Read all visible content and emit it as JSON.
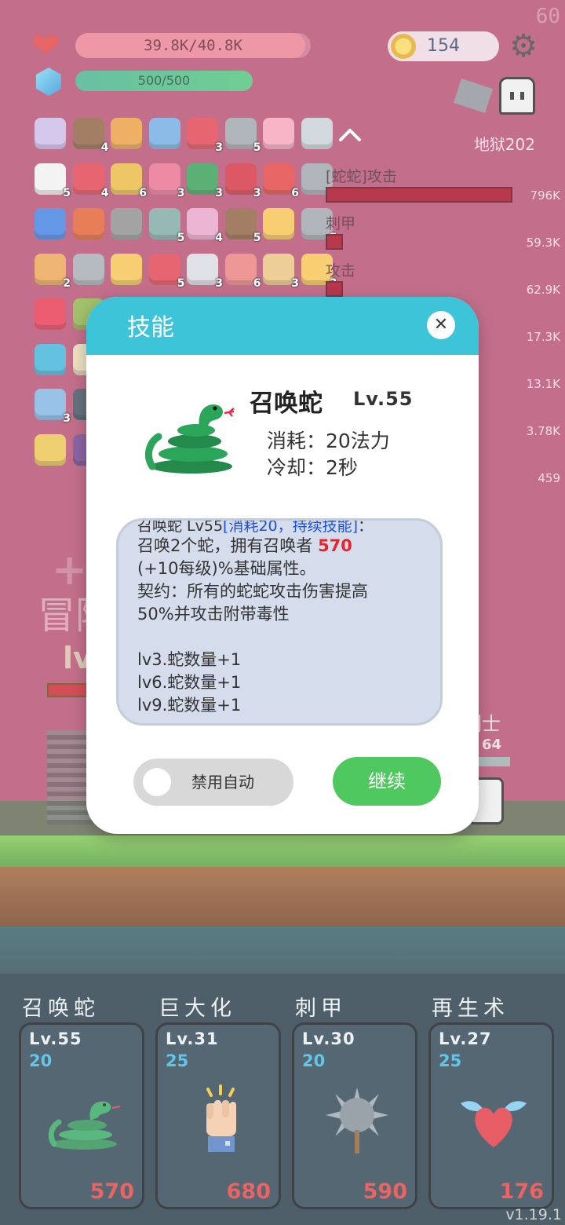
{
  "fps": "60",
  "hud": {
    "hp_text": "39.8K/40.8K",
    "hp_ratio": 0.976,
    "mp_text": "500/500",
    "mp_ratio": 1.0,
    "coins": "154",
    "stage": "地狱202"
  },
  "items": [
    {
      "row": 0,
      "col": 0,
      "color": "#c8b9e8",
      "count": ""
    },
    {
      "row": 0,
      "col": 1,
      "color": "#8a5a3a",
      "count": "4"
    },
    {
      "row": 0,
      "col": 2,
      "color": "#e89a3a",
      "count": ""
    },
    {
      "row": 0,
      "col": 3,
      "color": "#6aa9e0",
      "count": ""
    },
    {
      "row": 0,
      "col": 4,
      "color": "#e03a4a",
      "count": "3"
    },
    {
      "row": 0,
      "col": 5,
      "color": "#9aa0a8",
      "count": "5"
    },
    {
      "row": 0,
      "col": 6,
      "color": "#f5a0b8",
      "count": ""
    },
    {
      "row": 0,
      "col": 7,
      "color": "#c5cdd5",
      "count": ""
    },
    {
      "row": 1,
      "col": 0,
      "color": "#f0f0f0",
      "count": "5"
    },
    {
      "row": 1,
      "col": 1,
      "color": "#e03a4a",
      "count": "4"
    },
    {
      "row": 1,
      "col": 2,
      "color": "#e8b73a",
      "count": "6"
    },
    {
      "row": 1,
      "col": 3,
      "color": "#e86a8a",
      "count": "3"
    },
    {
      "row": 1,
      "col": 4,
      "color": "#2e9a4f",
      "count": "3"
    },
    {
      "row": 1,
      "col": 5,
      "color": "#d42a3a",
      "count": "3"
    },
    {
      "row": 1,
      "col": 6,
      "color": "#e03a3a",
      "count": "6"
    },
    {
      "row": 1,
      "col": 7,
      "color": "#9aa0a8",
      "count": "5"
    },
    {
      "row": 2,
      "col": 0,
      "color": "#3a7ae0",
      "count": ""
    },
    {
      "row": 2,
      "col": 1,
      "color": "#e05a2a",
      "count": ""
    },
    {
      "row": 2,
      "col": 2,
      "color": "#8a8a8a",
      "count": ""
    },
    {
      "row": 2,
      "col": 3,
      "color": "#7aa6a0",
      "count": "5"
    },
    {
      "row": 2,
      "col": 4,
      "color": "#e8a0c8",
      "count": "4"
    },
    {
      "row": 2,
      "col": 5,
      "color": "#8a5a3a",
      "count": "5"
    },
    {
      "row": 2,
      "col": 6,
      "color": "#f5c04a",
      "count": ""
    },
    {
      "row": 2,
      "col": 7,
      "color": "#9aa0a8",
      "count": "5"
    },
    {
      "row": 3,
      "col": 0,
      "color": "#e8a04a",
      "count": "2"
    },
    {
      "row": 3,
      "col": 1,
      "color": "#a0a8b0",
      "count": ""
    },
    {
      "row": 3,
      "col": 2,
      "color": "#f5c04a",
      "count": ""
    },
    {
      "row": 3,
      "col": 3,
      "color": "#e03a4a",
      "count": "5"
    },
    {
      "row": 3,
      "col": 4,
      "color": "#d8d8e0",
      "count": "3"
    },
    {
      "row": 3,
      "col": 5,
      "color": "#e87a7a",
      "count": "6"
    },
    {
      "row": 3,
      "col": 6,
      "color": "#e8c07a",
      "count": "3"
    },
    {
      "row": 3,
      "col": 7,
      "color": "#f5c04a",
      "count": "3"
    },
    {
      "row": 4,
      "col": 0,
      "color": "#e8304a",
      "count": ""
    },
    {
      "row": 4,
      "col": 1,
      "color": "#8ab040",
      "count": ""
    },
    {
      "row": 5,
      "col": 0,
      "color": "#3ab0d8",
      "count": ""
    },
    {
      "row": 5,
      "col": 1,
      "color": "#e8d8b0",
      "count": ""
    },
    {
      "row": 6,
      "col": 0,
      "color": "#7ab0e0",
      "count": "3"
    },
    {
      "row": 6,
      "col": 1,
      "color": "#3a4a5a",
      "count": ""
    },
    {
      "row": 7,
      "col": 0,
      "color": "#e8c04a",
      "count": ""
    },
    {
      "row": 7,
      "col": 1,
      "color": "#6a3a8a",
      "count": ""
    }
  ],
  "damage_stats": [
    {
      "label": "[蛇蛇]攻击",
      "value": "796K",
      "ratio": 1.0
    },
    {
      "label": "刺甲",
      "value": "59.3K",
      "ratio": 0.08
    },
    {
      "label": "攻击",
      "value": "62.9K",
      "ratio": 0.08
    },
    {
      "label": "",
      "value": "17.3K",
      "ratio": 0.0
    },
    {
      "label": "",
      "value": "13.1K",
      "ratio": 0.0
    },
    {
      "label": "",
      "value": "3.78K",
      "ratio": 0.0
    },
    {
      "label": "",
      "value": "459",
      "ratio": 0.0
    }
  ],
  "background": {
    "big_text": "冒险",
    "lv_text": "lv",
    "hero_name": "剑士",
    "hero_lv": "64"
  },
  "modal": {
    "title": "技能",
    "skill_name": "召唤蛇",
    "skill_level": "Lv.55",
    "cost": "消耗：20法力",
    "cooldown": "冷却：2秒",
    "desc_head_prefix": "召唤蛇 Lv55",
    "desc_head_highlight": "[消耗20，持续技能]",
    "desc_head_suffix": "：",
    "desc_line1_a": "召唤2个蛇，拥有召唤者",
    "desc_line1_value": "570",
    "desc_line2": "(+10每级)%基础属性。",
    "desc_line3": "契约：所有的蛇蛇攻击伤害提高",
    "desc_line4": "50%并攻击附带毒性",
    "desc_bonus": [
      "lv3.蛇数量+1",
      "lv6.蛇数量+1",
      "lv9.蛇数量+1"
    ],
    "toggle_label": "禁用自动",
    "continue_label": "继续"
  },
  "skills": [
    {
      "name": "召唤蛇",
      "level": "Lv.55",
      "cost": "20",
      "value": "570",
      "icon": "snake-icon"
    },
    {
      "name": "巨大化",
      "level": "Lv.31",
      "cost": "25",
      "value": "680",
      "icon": "fist-icon"
    },
    {
      "name": "刺甲",
      "level": "Lv.30",
      "cost": "20",
      "value": "590",
      "icon": "spiked-ball-icon"
    },
    {
      "name": "再生术",
      "level": "Lv.27",
      "cost": "25",
      "value": "176",
      "icon": "winged-heart-icon"
    }
  ],
  "version": "v1.19.1"
}
